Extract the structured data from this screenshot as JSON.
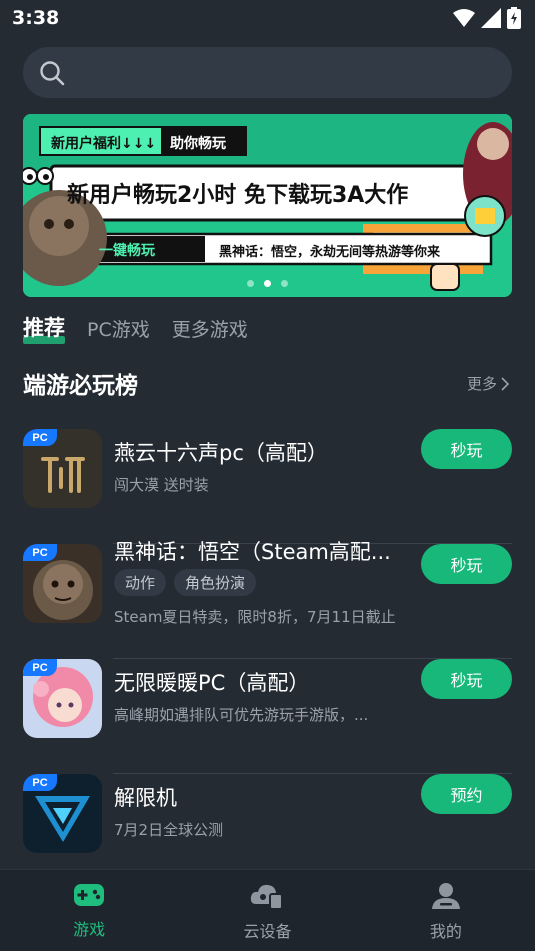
{
  "status_bar": {
    "time": "3:38"
  },
  "search": {
    "placeholder": ""
  },
  "banner": {
    "tag1": "新用户福利↓↓↓",
    "tag2": "助你畅玩",
    "headline": "新用户畅玩2小时 免下载玩3A大作",
    "cta": "一键畅玩",
    "subline": "黑神话：悟空，永劫无间等热游等你来",
    "dots": 3,
    "active_dot": 1
  },
  "tabs": [
    {
      "label": "推荐",
      "active": true
    },
    {
      "label": "PC游戏",
      "active": false
    },
    {
      "label": "更多游戏",
      "active": false
    }
  ],
  "section": {
    "title": "端游必玩榜",
    "more_label": "更多"
  },
  "games": [
    {
      "badge": "PC",
      "name": "燕云十六声pc（高配）",
      "subtitle": "闯大漠 送时装",
      "tags": [],
      "button": "秒玩"
    },
    {
      "badge": "PC",
      "name": "黑神话：悟空（Steam高配...",
      "subtitle": "Steam夏日特卖，限时8折，7月11日截止",
      "tags": [
        "动作",
        "角色扮演"
      ],
      "button": "秒玩"
    },
    {
      "badge": "PC",
      "name": "无限暖暖PC（高配）",
      "subtitle": "高峰期如遇排队可优先游玩手游版，...",
      "tags": [],
      "button": "秒玩"
    },
    {
      "badge": "PC",
      "name": "解限机",
      "subtitle": "7月2日全球公测",
      "tags": [],
      "button": "预约"
    }
  ],
  "bottom_nav": [
    {
      "label": "游戏",
      "icon": "gamepad-icon",
      "active": true
    },
    {
      "label": "云设备",
      "icon": "cloud-device-icon",
      "active": false
    },
    {
      "label": "我的",
      "icon": "profile-icon",
      "active": false
    }
  ],
  "colors": {
    "background": "#252b33",
    "accent": "#1fbd7e",
    "button": "#17b87a",
    "badge": "#1677ff"
  }
}
